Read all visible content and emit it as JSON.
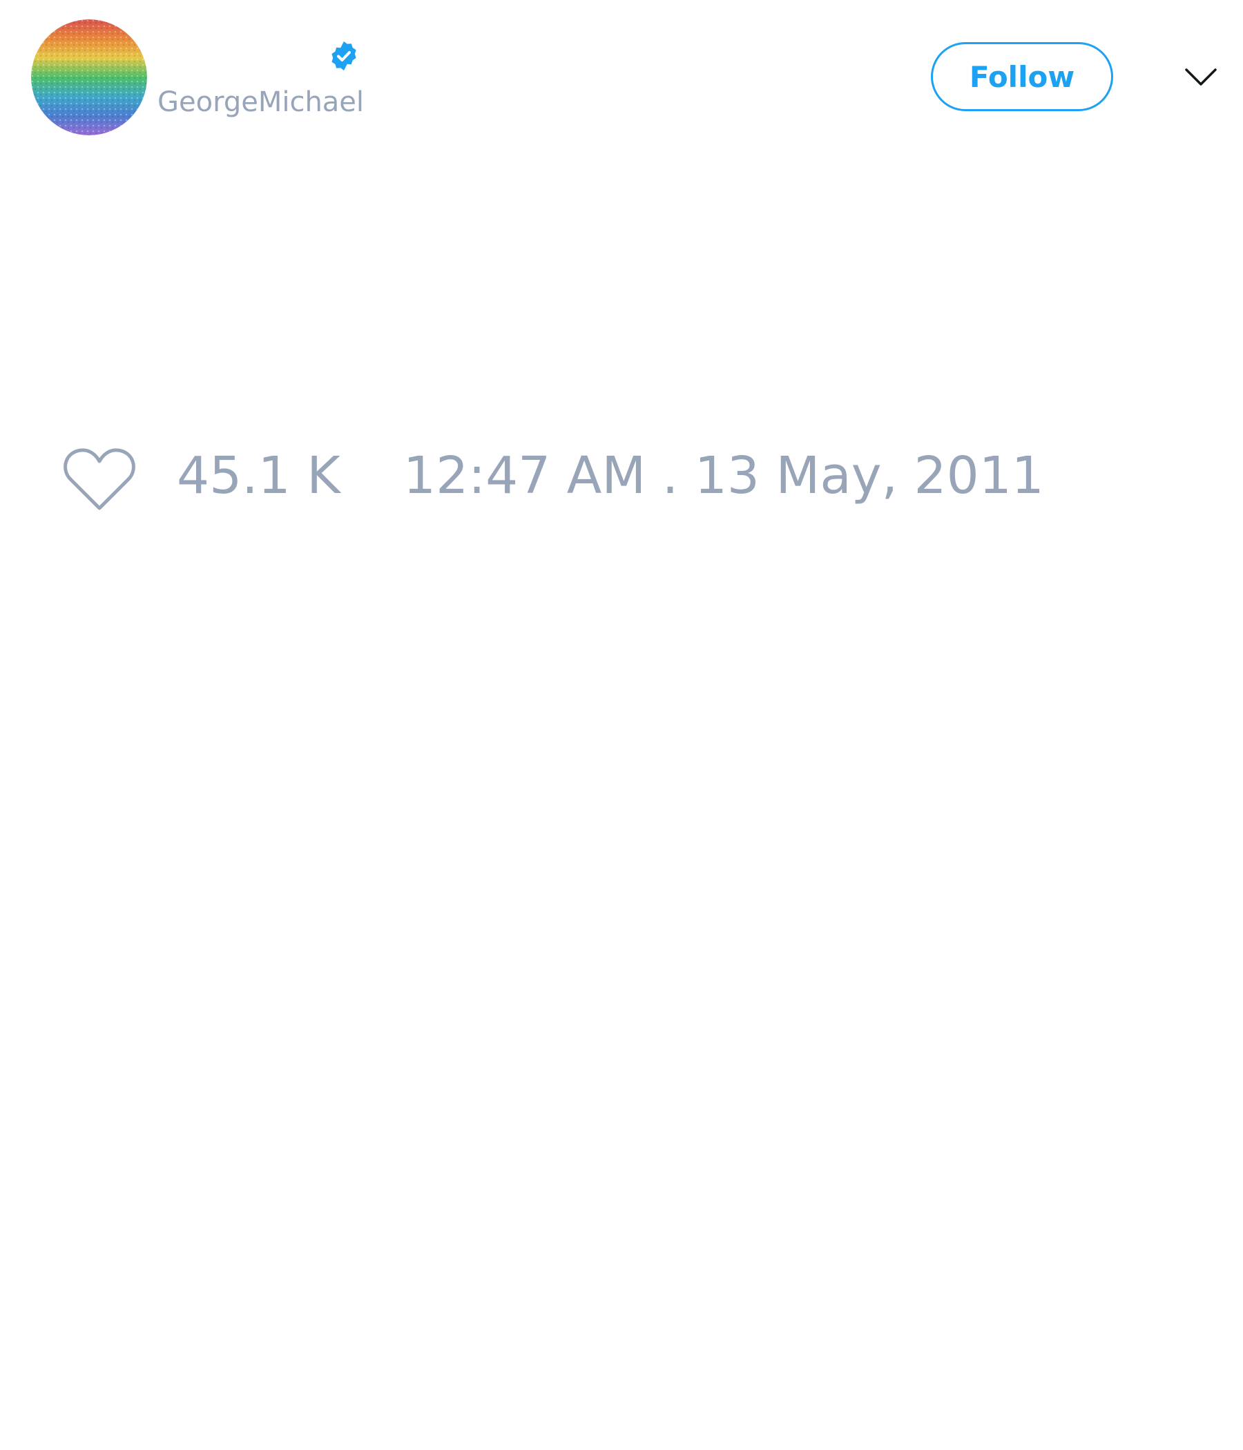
{
  "tweet": {
    "author": {
      "display_name": "",
      "username": "GeorgeMichael",
      "verified": true,
      "avatar": "rainbow-glitter-avatar"
    },
    "follow_label": "Follow",
    "menu_icon": "chevron-down-icon",
    "likes": {
      "icon": "heart-outline-icon",
      "count": "45.1 K"
    },
    "timestamp": "12:47 AM . 13 May, 2011"
  },
  "colors": {
    "accent": "#1da1f2",
    "muted_text": "#98a5b8",
    "background": "#ffffff"
  }
}
